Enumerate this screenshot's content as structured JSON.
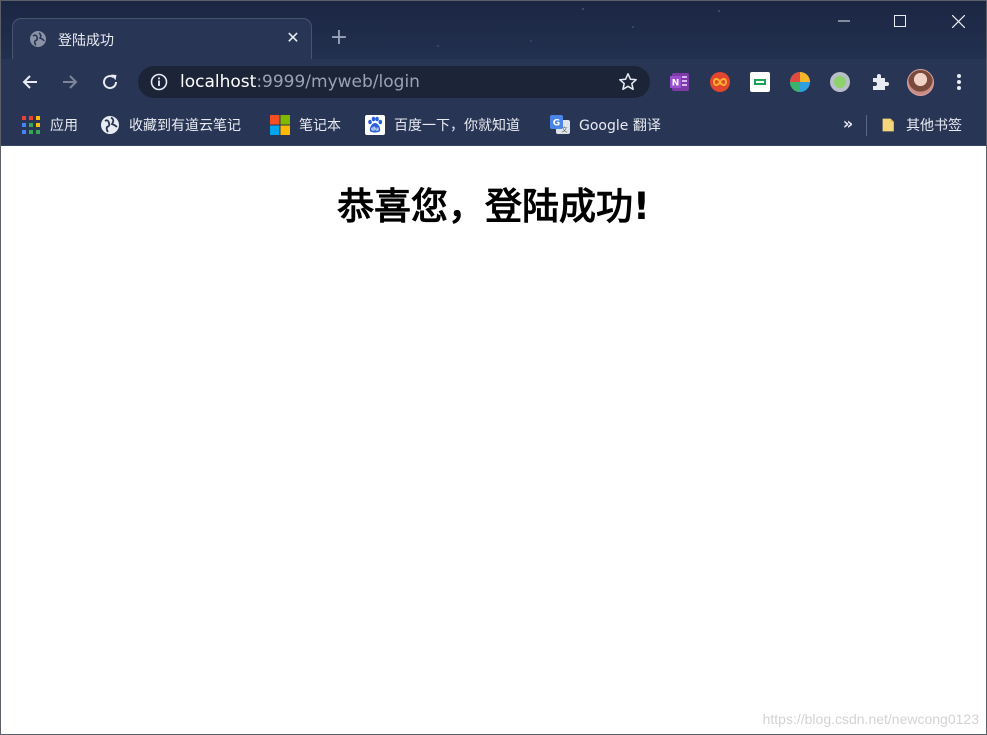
{
  "window": {
    "controls": {
      "minimize_icon": "minimize-icon",
      "maximize_icon": "maximize-icon",
      "close_icon": "close-icon"
    }
  },
  "tab": {
    "title": "登陆成功",
    "favicon": "globe-icon",
    "close_symbol": "✕",
    "new_tab_symbol": "+"
  },
  "toolbar": {
    "url_host": "localhost",
    "url_rest": ":9999/myweb/login",
    "extensions": [
      "onenote-icon",
      "infinity-icon",
      "extension-green-icon",
      "colorful-circle-icon",
      "circle-extension-icon",
      "puzzle-icon"
    ]
  },
  "bookmarks": {
    "items": [
      {
        "label": "应用",
        "icon": "apps-grid-icon"
      },
      {
        "label": "收藏到有道云笔记",
        "icon": "globe-icon"
      },
      {
        "label": "笔记本",
        "icon": "microsoft-logo-icon"
      },
      {
        "label": "百度一下，你就知道",
        "icon": "baidu-icon"
      },
      {
        "label": "Google 翻译",
        "icon": "google-translate-icon"
      }
    ],
    "more_symbol": "»",
    "other_label": "其他书签"
  },
  "page": {
    "heading": "恭喜您，登陆成功!",
    "watermark": "https://blog.csdn.net/newcong0123"
  },
  "colors": {
    "frame": "#1e2a47",
    "toolbar": "#283554",
    "omnibox": "#1c2438",
    "page_bg": "#ffffff"
  }
}
